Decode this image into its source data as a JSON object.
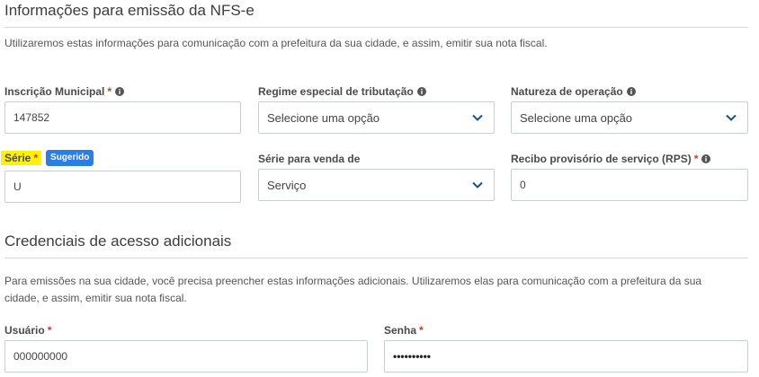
{
  "section1": {
    "title": "Informações para emissão da NFS-e",
    "description": "Utilizaremos estas informações para comunicação com a prefeitura da sua cidade, e assim, emitir sua nota fiscal."
  },
  "fields": {
    "inscricao": {
      "label": "Inscrição Municipal",
      "required_mark": "*",
      "value": "147852",
      "icon": "info-icon"
    },
    "regime": {
      "label": "Regime especial de tributação",
      "value": "Selecione uma opção",
      "icon": "info-icon"
    },
    "natureza": {
      "label": "Natureza de operação",
      "value": "Selecione uma opção",
      "icon": "info-icon"
    },
    "serie": {
      "label": "Série",
      "required_mark": "*",
      "badge": "Sugerido",
      "value": "U"
    },
    "serie_venda": {
      "label": "Série para venda de",
      "value": "Serviço"
    },
    "rps": {
      "label": "Recibo provisório de serviço (RPS)",
      "required_mark": "*",
      "value": "0",
      "icon": "info-icon"
    }
  },
  "section2": {
    "title": "Credenciais de acesso adicionais",
    "description": "Para emissões na sua cidade, você precisa preencher estas informações adicionais. Utilizaremos elas para comunicação com a prefeitura da sua cidade, e assim, emitir sua nota fiscal."
  },
  "credentials": {
    "usuario": {
      "label": "Usuário",
      "required_mark": "*",
      "value": "000000000"
    },
    "senha": {
      "label": "Senha",
      "required_mark": "*",
      "value": "••••••••••"
    }
  },
  "colors": {
    "required": "#d9342b",
    "badge": "#2b7de9",
    "highlight": "#fff200",
    "chevron": "#1a4f8b"
  }
}
